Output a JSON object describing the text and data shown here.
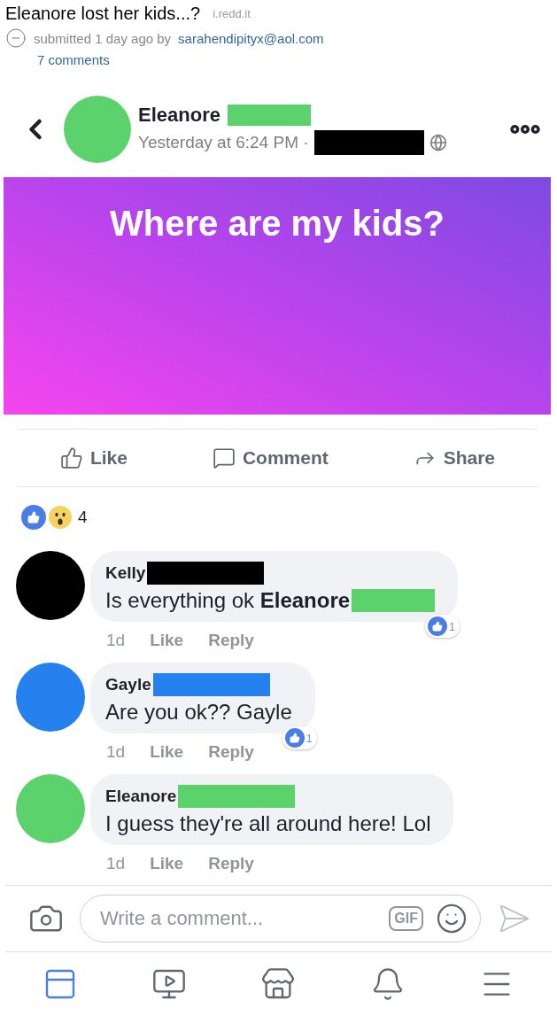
{
  "reddit_post": {
    "title": "Eleanore lost her kids...?",
    "domain": "i.redd.it",
    "submitted": "submitted 1 day ago by",
    "user": "sarahendipityx@aol.com",
    "comments_link": "7 comments"
  },
  "post": {
    "author": "Eleanore",
    "color": "#5cd26d",
    "time": "Yesterday at 6:24 PM ·",
    "text": "Where are my kids?"
  },
  "actions": [
    {
      "kind": "like",
      "label": "Like"
    },
    {
      "kind": "comment",
      "label": "Comment"
    },
    {
      "kind": "share",
      "label": "Share"
    }
  ],
  "reactions": {
    "count": "4"
  },
  "comments": [
    {
      "author": "Kelly",
      "color": "#000000",
      "body": "Is everything ok **Eleanore**",
      "mention": {
        "color": "#5cd26d"
      },
      "time": "1d",
      "like": "Like",
      "reply": "Reply",
      "likes": "1"
    },
    {
      "author": "Gayle",
      "color": "#2481ee",
      "body": "Are you ok?? Gayle",
      "time": "1d",
      "like": "Like",
      "reply": "Reply",
      "likes": "1"
    },
    {
      "author": "Eleanore",
      "color": "#5cd26d",
      "body": "I guess they're all around here! Lol",
      "time": "1d",
      "like": "Like",
      "reply": "Reply"
    }
  ],
  "composer": {
    "placeholder": "Write a comment...",
    "gif": "GIF"
  },
  "nav": [
    {
      "kind": "feed",
      "selected": true
    },
    {
      "kind": "video",
      "selected": false
    },
    {
      "kind": "marketplace",
      "selected": false
    },
    {
      "kind": "notifications",
      "selected": false
    },
    {
      "kind": "menu",
      "selected": false
    }
  ]
}
